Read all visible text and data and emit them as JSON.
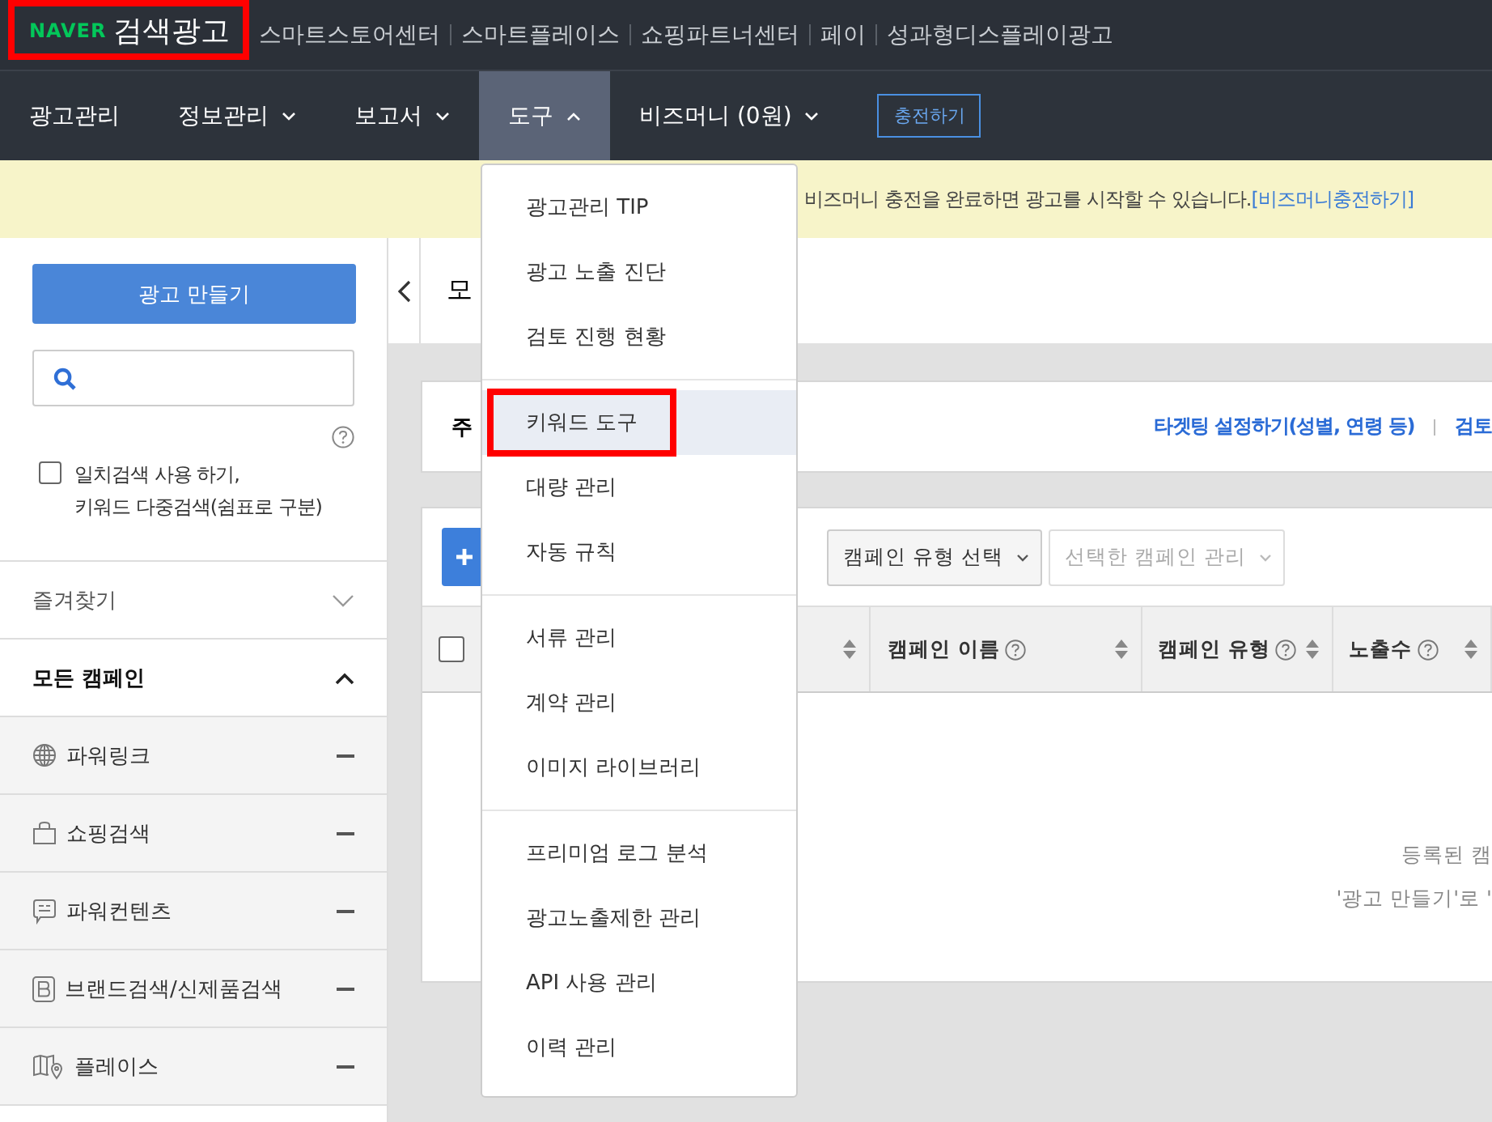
{
  "logo": {
    "brand": "NAVER",
    "product": "검색광고",
    "highlighted": true
  },
  "top_links": [
    "스마트스토어센터",
    "스마트플레이스",
    "쇼핑파트너센터",
    "페이",
    "성과형디스플레이광고"
  ],
  "nav": [
    {
      "label": "광고관리",
      "selected": false
    },
    {
      "label": "정보관리",
      "expanded": false,
      "selected": false
    },
    {
      "label": "보고서",
      "expanded": false,
      "selected": false
    },
    {
      "label": "도구",
      "expanded": true,
      "selected": true
    },
    {
      "label": "비즈머니 (0원)",
      "expanded": false,
      "selected": false
    }
  ],
  "charge_button": "충전하기",
  "banner": {
    "text": "비즈머니 충전을 완료하면 광고를 시작할 수 있습니다.",
    "link": "[비즈머니충전하기]"
  },
  "sidebar": {
    "create_button": "광고 만들기",
    "exact_match": {
      "checked": false,
      "label": "일치검색 사용 하기,\n키워드 다중검색(쉼표로 구분)"
    },
    "favorites": {
      "label": "즐겨찾기",
      "expanded": false
    },
    "all_campaigns": {
      "label": "모든 캠페인",
      "expanded": true
    },
    "campaign_types": [
      {
        "label": "파워링크",
        "kind": "globe"
      },
      {
        "label": "쇼핑검색",
        "kind": "bag"
      },
      {
        "label": "파워컨텐츠",
        "kind": "chat"
      },
      {
        "label": "브랜드검색/신제품검색",
        "kind": "brand"
      },
      {
        "label": "플레이스",
        "kind": "map"
      }
    ]
  },
  "main": {
    "title": "모",
    "summary_label": "주",
    "links": [
      "타겟팅 설정하기(성별, 연령 등)",
      "검토"
    ],
    "filters": [
      {
        "label": "캠페인 유형 선택",
        "disabled": false
      },
      {
        "label": "선택한 캠페인 관리",
        "disabled": true
      }
    ],
    "select_all_checked": false,
    "columns": [
      "캠페인 이름",
      "캠페인 유형",
      "노출수"
    ],
    "empty_text": [
      "등록된 캠",
      "'광고 만들기'로 '"
    ]
  },
  "tools_menu": [
    [
      {
        "label": "광고관리 TIP",
        "selected": false,
        "highlighted": false
      },
      {
        "label": "광고 노출 진단",
        "selected": false,
        "highlighted": false
      },
      {
        "label": "검토 진행 현황",
        "selected": false,
        "highlighted": false
      }
    ],
    [
      {
        "label": "키워드 도구",
        "selected": true,
        "highlighted": true
      },
      {
        "label": "대량 관리",
        "selected": false,
        "highlighted": false
      },
      {
        "label": "자동 규칙",
        "selected": false,
        "highlighted": false
      }
    ],
    [
      {
        "label": "서류 관리",
        "selected": false,
        "highlighted": false
      },
      {
        "label": "계약 관리",
        "selected": false,
        "highlighted": false
      },
      {
        "label": "이미지 라이브러리",
        "selected": false,
        "highlighted": false
      }
    ],
    [
      {
        "label": "프리미엄 로그 분석",
        "selected": false,
        "highlighted": false
      },
      {
        "label": "광고노출제한 관리",
        "selected": false,
        "highlighted": false
      },
      {
        "label": "API 사용 관리",
        "selected": false,
        "highlighted": false
      },
      {
        "label": "이력 관리",
        "selected": false,
        "highlighted": false
      }
    ]
  ]
}
